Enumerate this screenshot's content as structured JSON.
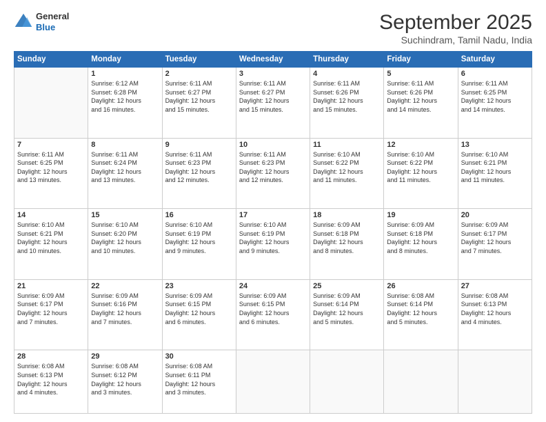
{
  "logo": {
    "line1": "General",
    "line2": "Blue"
  },
  "title": "September 2025",
  "subtitle": "Suchindram, Tamil Nadu, India",
  "days_of_week": [
    "Sunday",
    "Monday",
    "Tuesday",
    "Wednesday",
    "Thursday",
    "Friday",
    "Saturday"
  ],
  "weeks": [
    [
      {
        "num": "",
        "info": ""
      },
      {
        "num": "1",
        "info": "Sunrise: 6:12 AM\nSunset: 6:28 PM\nDaylight: 12 hours\nand 16 minutes."
      },
      {
        "num": "2",
        "info": "Sunrise: 6:11 AM\nSunset: 6:27 PM\nDaylight: 12 hours\nand 15 minutes."
      },
      {
        "num": "3",
        "info": "Sunrise: 6:11 AM\nSunset: 6:27 PM\nDaylight: 12 hours\nand 15 minutes."
      },
      {
        "num": "4",
        "info": "Sunrise: 6:11 AM\nSunset: 6:26 PM\nDaylight: 12 hours\nand 15 minutes."
      },
      {
        "num": "5",
        "info": "Sunrise: 6:11 AM\nSunset: 6:26 PM\nDaylight: 12 hours\nand 14 minutes."
      },
      {
        "num": "6",
        "info": "Sunrise: 6:11 AM\nSunset: 6:25 PM\nDaylight: 12 hours\nand 14 minutes."
      }
    ],
    [
      {
        "num": "7",
        "info": "Sunrise: 6:11 AM\nSunset: 6:25 PM\nDaylight: 12 hours\nand 13 minutes."
      },
      {
        "num": "8",
        "info": "Sunrise: 6:11 AM\nSunset: 6:24 PM\nDaylight: 12 hours\nand 13 minutes."
      },
      {
        "num": "9",
        "info": "Sunrise: 6:11 AM\nSunset: 6:23 PM\nDaylight: 12 hours\nand 12 minutes."
      },
      {
        "num": "10",
        "info": "Sunrise: 6:11 AM\nSunset: 6:23 PM\nDaylight: 12 hours\nand 12 minutes."
      },
      {
        "num": "11",
        "info": "Sunrise: 6:10 AM\nSunset: 6:22 PM\nDaylight: 12 hours\nand 11 minutes."
      },
      {
        "num": "12",
        "info": "Sunrise: 6:10 AM\nSunset: 6:22 PM\nDaylight: 12 hours\nand 11 minutes."
      },
      {
        "num": "13",
        "info": "Sunrise: 6:10 AM\nSunset: 6:21 PM\nDaylight: 12 hours\nand 11 minutes."
      }
    ],
    [
      {
        "num": "14",
        "info": "Sunrise: 6:10 AM\nSunset: 6:21 PM\nDaylight: 12 hours\nand 10 minutes."
      },
      {
        "num": "15",
        "info": "Sunrise: 6:10 AM\nSunset: 6:20 PM\nDaylight: 12 hours\nand 10 minutes."
      },
      {
        "num": "16",
        "info": "Sunrise: 6:10 AM\nSunset: 6:19 PM\nDaylight: 12 hours\nand 9 minutes."
      },
      {
        "num": "17",
        "info": "Sunrise: 6:10 AM\nSunset: 6:19 PM\nDaylight: 12 hours\nand 9 minutes."
      },
      {
        "num": "18",
        "info": "Sunrise: 6:09 AM\nSunset: 6:18 PM\nDaylight: 12 hours\nand 8 minutes."
      },
      {
        "num": "19",
        "info": "Sunrise: 6:09 AM\nSunset: 6:18 PM\nDaylight: 12 hours\nand 8 minutes."
      },
      {
        "num": "20",
        "info": "Sunrise: 6:09 AM\nSunset: 6:17 PM\nDaylight: 12 hours\nand 7 minutes."
      }
    ],
    [
      {
        "num": "21",
        "info": "Sunrise: 6:09 AM\nSunset: 6:17 PM\nDaylight: 12 hours\nand 7 minutes."
      },
      {
        "num": "22",
        "info": "Sunrise: 6:09 AM\nSunset: 6:16 PM\nDaylight: 12 hours\nand 7 minutes."
      },
      {
        "num": "23",
        "info": "Sunrise: 6:09 AM\nSunset: 6:15 PM\nDaylight: 12 hours\nand 6 minutes."
      },
      {
        "num": "24",
        "info": "Sunrise: 6:09 AM\nSunset: 6:15 PM\nDaylight: 12 hours\nand 6 minutes."
      },
      {
        "num": "25",
        "info": "Sunrise: 6:09 AM\nSunset: 6:14 PM\nDaylight: 12 hours\nand 5 minutes."
      },
      {
        "num": "26",
        "info": "Sunrise: 6:08 AM\nSunset: 6:14 PM\nDaylight: 12 hours\nand 5 minutes."
      },
      {
        "num": "27",
        "info": "Sunrise: 6:08 AM\nSunset: 6:13 PM\nDaylight: 12 hours\nand 4 minutes."
      }
    ],
    [
      {
        "num": "28",
        "info": "Sunrise: 6:08 AM\nSunset: 6:13 PM\nDaylight: 12 hours\nand 4 minutes."
      },
      {
        "num": "29",
        "info": "Sunrise: 6:08 AM\nSunset: 6:12 PM\nDaylight: 12 hours\nand 3 minutes."
      },
      {
        "num": "30",
        "info": "Sunrise: 6:08 AM\nSunset: 6:11 PM\nDaylight: 12 hours\nand 3 minutes."
      },
      {
        "num": "",
        "info": ""
      },
      {
        "num": "",
        "info": ""
      },
      {
        "num": "",
        "info": ""
      },
      {
        "num": "",
        "info": ""
      }
    ]
  ]
}
